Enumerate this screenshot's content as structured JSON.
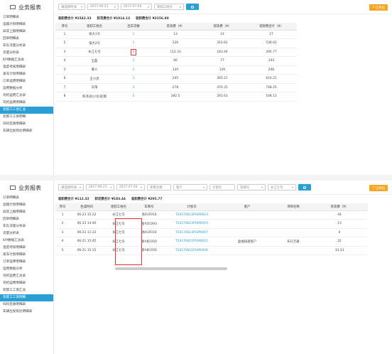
{
  "p1": {
    "brand": "业务报表",
    "nav": [
      "订单明细表",
      "运输计划明细表",
      "异常上报明细表",
      "回单明细表",
      "车队流量分析表",
      "流量分析表",
      "KPI数据汇总表",
      "温度考核明细表",
      "发车计划明细表",
      "订单运费明细表",
      "运费数据分析",
      "司机运费汇总表",
      "司机运费明细表",
      "装卸工工资汇总",
      "装卸工工资明细",
      "扫码签收明细表",
      "车辆出发到达明细表"
    ],
    "active_index": 13,
    "filters": {
      "type": "请选择时间",
      "date_from": "2017-06-21",
      "date_to": "2017-07-04",
      "worker": "装卸工姓名"
    },
    "export_label": "已导出",
    "summary": [
      "装卸费合计 ¥1542.33",
      "卸货费合计 ¥1014.13",
      "装卸费合计 ¥3156.80"
    ],
    "headers": [
      "序号",
      "装卸工姓名",
      "出车次数",
      "装货费（¥）",
      "卸货费（¥）",
      "装卸费合计（¥）"
    ],
    "rows": [
      [
        "1",
        "张大1号",
        "1",
        "13",
        "14",
        "27"
      ],
      [
        "2",
        "张大2号",
        "1",
        "226",
        "312.62",
        "538.62"
      ],
      [
        "3",
        "长江七号",
        "5",
        "112.33",
        "183.44",
        "295.77"
      ],
      [
        "4",
        "王磊",
        "1",
        "66",
        "77",
        "143"
      ],
      [
        "5",
        "尊人",
        "2",
        "120",
        "126",
        "246"
      ],
      [
        "6",
        "王小虎",
        "3",
        "245",
        "365.21",
        "610.21"
      ],
      [
        "7",
        "东阳",
        "3",
        "278",
        "470.25",
        "748.25"
      ],
      [
        "8",
        "陈泽/赵小龙/赵钢",
        "5",
        "282.5",
        "265.63",
        "548.13"
      ]
    ]
  },
  "p2": {
    "brand": "业务报表",
    "nav": [
      "订单明细表",
      "运输计划明细表",
      "异常上报明细表",
      "回单明细表",
      "车队流量分析表",
      "流量分析表",
      "KPI数据汇总表",
      "温度考核明细表",
      "发车计划明细表",
      "订单运费明细表",
      "运费数据分析",
      "司机运费汇总表",
      "司机运费明细表",
      "装卸工工资汇总",
      "装卸工工资明细",
      "扫码签收明细表",
      "车辆出发到达明细表"
    ],
    "active_index": 14,
    "filters": {
      "type": "请选择时间",
      "date_from": "2017-06-21",
      "date_to": "2017-07-04",
      "route": "项目名称",
      "customer": "客户",
      "plan": "计划号",
      "truck": "车牌号",
      "worker": "长江七号"
    },
    "export_label": "已导出",
    "summary": [
      "装卸费合计 ¥112.33",
      "卸货费合计 ¥183.44",
      "装卸费合计 ¥295.77"
    ],
    "headers": [
      "序号",
      "生成时间",
      "装卸工姓名",
      "车牌号",
      "计划号",
      "客户",
      "项目名称",
      "装货费（¥）"
    ],
    "rows": [
      [
        "1",
        "06-23 15:22",
        "长江七号",
        "浙A1F016",
        "T20170623PGM0024",
        "",
        "",
        "44"
      ],
      [
        "2",
        "06-23 14:40",
        "长江七号",
        "浙A5C093",
        "T20170623PGM0010",
        "",
        "",
        "13"
      ],
      [
        "3",
        "06-23 11:22",
        "长江七号",
        "浙A1F016",
        "T20170623PGM0007",
        "",
        "",
        "0"
      ],
      [
        "4",
        "06-21 15:45",
        "长江七号",
        "浙A8C050",
        "T20170621PGM0011",
        "晶福快递客户",
        "821万通",
        "22"
      ],
      [
        "5",
        "06-21 15:15",
        "长江七号",
        "浙A8C050",
        "T20170621PGM0006",
        "",
        "",
        "33.33"
      ]
    ]
  }
}
